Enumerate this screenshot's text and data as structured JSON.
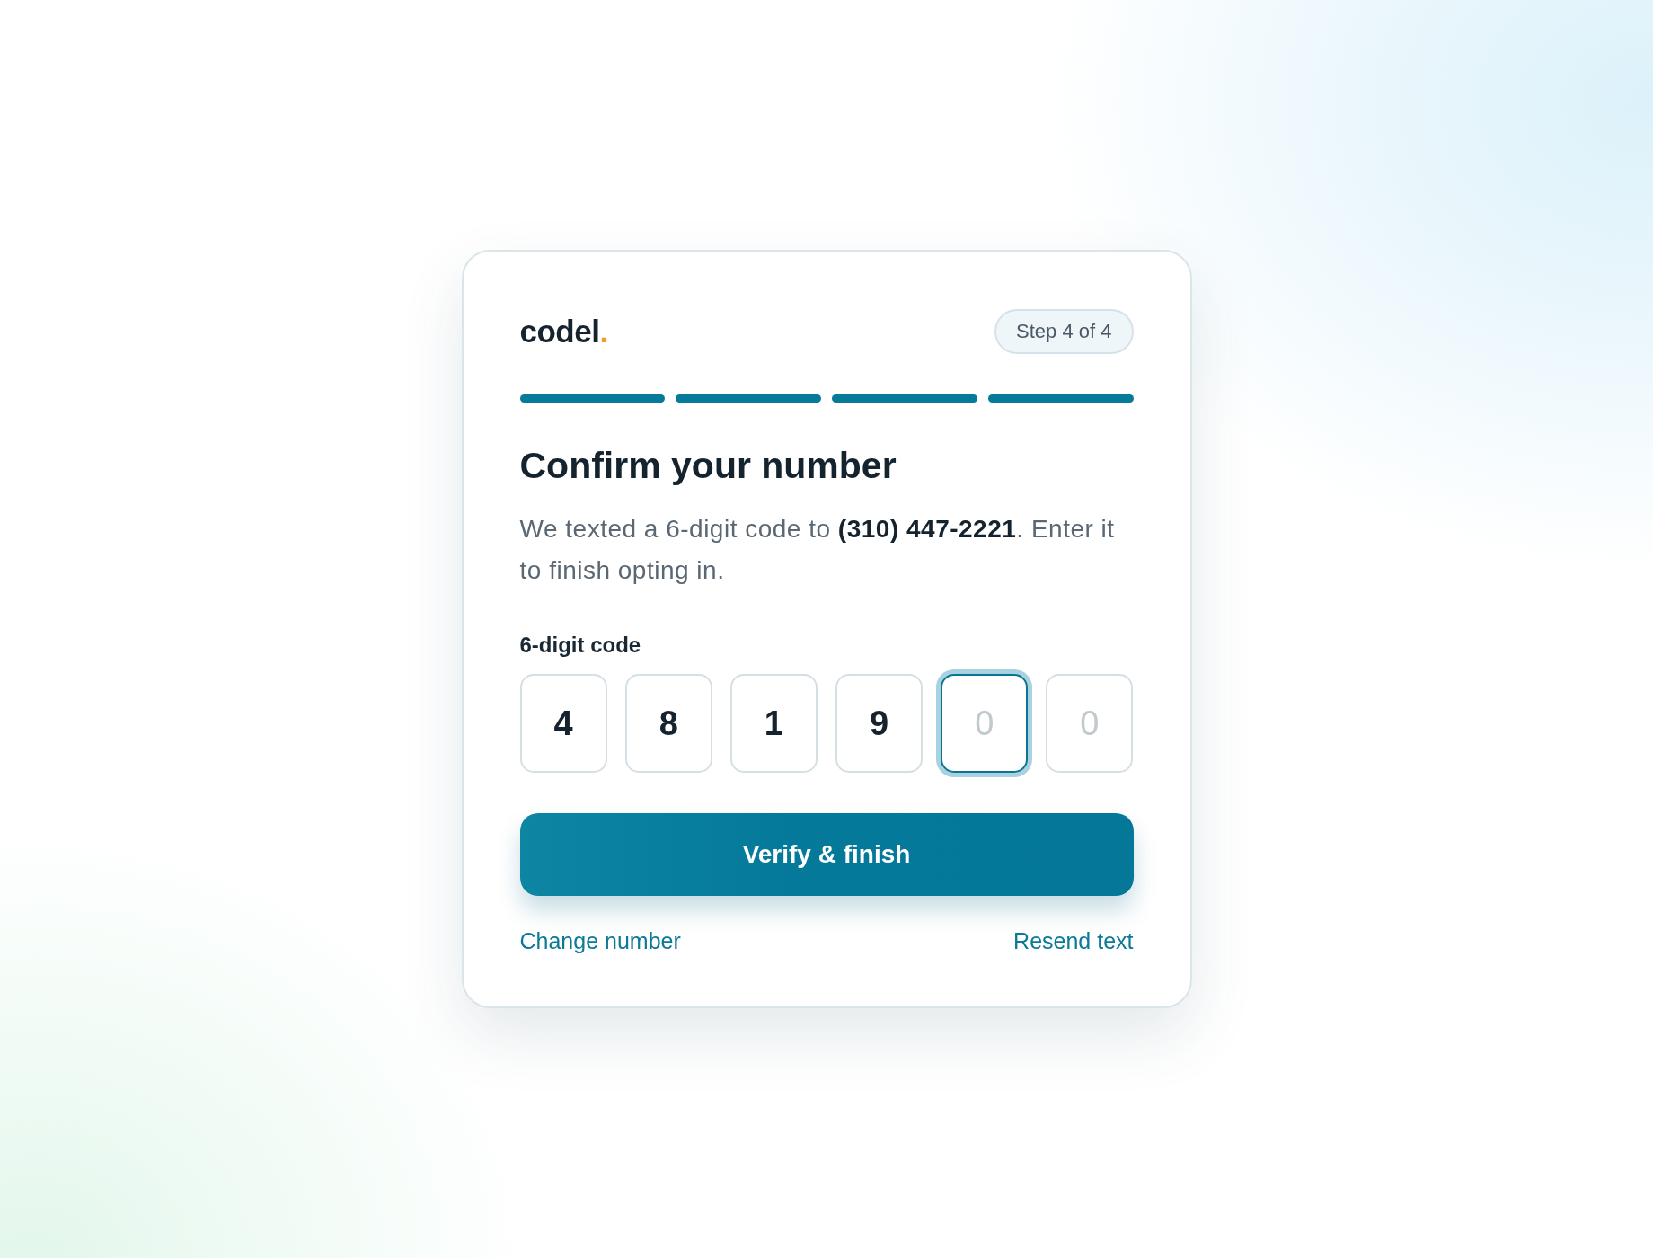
{
  "brand": {
    "name": "codel",
    "mark": "."
  },
  "step_badge": "Step 4 of 4",
  "progress": [
    {
      "complete": true
    },
    {
      "complete": true
    },
    {
      "complete": true
    },
    {
      "complete": true
    }
  ],
  "title": "Confirm your number",
  "description": "We texted a 6-digit code to **(310) 447-2221**. Enter it to finish opting in.",
  "code_field": {
    "label": "6-digit code",
    "digits": [
      {
        "value": "4",
        "focused": false
      },
      {
        "value": "8",
        "focused": false
      },
      {
        "value": "1",
        "focused": false
      },
      {
        "value": "9",
        "focused": false
      },
      {
        "placeholder": "0",
        "focused": true
      },
      {
        "placeholder": "0",
        "focused": false
      }
    ]
  },
  "primary_button": "Verify & finish",
  "links": [
    {
      "label": "Change number"
    },
    {
      "label": "Resend text"
    }
  ]
}
